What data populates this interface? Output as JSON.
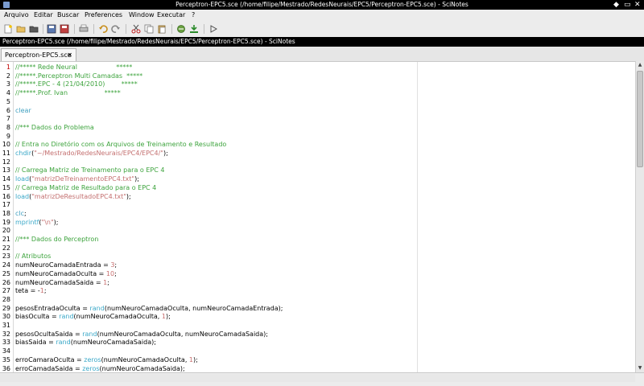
{
  "window": {
    "title": "Perceptron-EPC5.sce (/home/filipe/Mestrado/RedesNeurais/EPC5/Perceptron-EPC5.sce) - SciNotes",
    "controls": [
      "◆",
      "▭",
      "✕"
    ]
  },
  "menu": [
    {
      "label": "Arquivo"
    },
    {
      "label": "Editar"
    },
    {
      "label": "Buscar"
    },
    {
      "label": "Preferences"
    },
    {
      "label": "Window"
    },
    {
      "label": "Executar"
    },
    {
      "label": "?"
    }
  ],
  "toolbar": {
    "icons": [
      "new-file-icon",
      "open-file-icon",
      "open-recent-icon",
      "save-icon",
      "save-as-icon",
      "print-icon",
      "undo-icon",
      "redo-icon",
      "cut-icon",
      "copy-icon",
      "paste-icon",
      "execute-file-icon",
      "load-into-scilab-icon",
      "run-icon"
    ]
  },
  "pathbar": {
    "text": "Perceptron-EPC5.sce (/home/filipe/Mestrado/RedesNeurais/EPC5/Perceptron-EPC5.sce) - SciNotes"
  },
  "tab": {
    "label": "Perceptron-EPC5.sce",
    "close": "✕"
  },
  "editor": {
    "lines": [
      [
        [
          "com",
          "//***** Rede Neural                   *****"
        ]
      ],
      [
        [
          "com",
          "//*****.Perceptron Multi Camadas  *****"
        ]
      ],
      [
        [
          "com",
          "//*****.EPC - 4 (21/04/2010)        *****"
        ]
      ],
      [
        [
          "com",
          "//*****.Prof. Ivan                  *****"
        ]
      ],
      [],
      [
        [
          "kw",
          "clear"
        ]
      ],
      [],
      [
        [
          "com",
          "//*** Dados do Problema"
        ]
      ],
      [],
      [
        [
          "com",
          "// Entra no Diretório com os Arquivos de Treinamento e Resultado"
        ]
      ],
      [
        [
          "fn",
          "chdir"
        ],
        [
          "op",
          "("
        ],
        [
          "str",
          "\"~/Mestrado/RedesNeurais/EPC4/EPC4/\""
        ],
        [
          "op",
          ");"
        ]
      ],
      [],
      [
        [
          "com",
          "// Carrega Matriz de Treinamento para o EPC 4"
        ]
      ],
      [
        [
          "fn",
          "load"
        ],
        [
          "op",
          "("
        ],
        [
          "str",
          "\"matrizDeTreinamentoEPC4.txt\""
        ],
        [
          "op",
          ");"
        ]
      ],
      [
        [
          "com",
          "// Carrega Matriz de Resultado para o EPC 4"
        ]
      ],
      [
        [
          "fn",
          "load"
        ],
        [
          "op",
          "("
        ],
        [
          "str",
          "\"matrizDeResultadoEPC4.txt\""
        ],
        [
          "op",
          ");"
        ]
      ],
      [],
      [
        [
          "kw",
          "clc"
        ],
        [
          "op",
          ";"
        ]
      ],
      [
        [
          "fn",
          "mprintf"
        ],
        [
          "op",
          "("
        ],
        [
          "str",
          "\"\\n\""
        ],
        [
          "op",
          ");"
        ]
      ],
      [],
      [
        [
          "com",
          "//*** Dados do Perceptron"
        ]
      ],
      [],
      [
        [
          "com",
          "// Atributos"
        ]
      ],
      [
        [
          "id",
          "numNeuroCamadaEntrada "
        ],
        [
          "op",
          "= "
        ],
        [
          "num",
          "3"
        ],
        [
          "op",
          ";"
        ]
      ],
      [
        [
          "id",
          "numNeuroCamadaOculta "
        ],
        [
          "op",
          "= "
        ],
        [
          "num",
          "10"
        ],
        [
          "op",
          ";"
        ]
      ],
      [
        [
          "id",
          "numNeuroCamadaSaida "
        ],
        [
          "op",
          "= "
        ],
        [
          "num",
          "1"
        ],
        [
          "op",
          ";"
        ]
      ],
      [
        [
          "id",
          "teta "
        ],
        [
          "op",
          "= -"
        ],
        [
          "num",
          "1"
        ],
        [
          "op",
          ";"
        ]
      ],
      [],
      [
        [
          "id",
          "pesosEntradaOculta "
        ],
        [
          "op",
          "= "
        ],
        [
          "fn",
          "rand"
        ],
        [
          "op",
          "("
        ],
        [
          "id",
          "numNeuroCamadaOculta, numNeuroCamadaEntrada"
        ],
        [
          "op",
          ");"
        ]
      ],
      [
        [
          "id",
          "biasOculta "
        ],
        [
          "op",
          "= "
        ],
        [
          "fn",
          "rand"
        ],
        [
          "op",
          "("
        ],
        [
          "id",
          "numNeuroCamadaOculta, "
        ],
        [
          "num",
          "1"
        ],
        [
          "op",
          ");"
        ]
      ],
      [],
      [
        [
          "id",
          "pesosOcultaSaida "
        ],
        [
          "op",
          "= "
        ],
        [
          "fn",
          "rand"
        ],
        [
          "op",
          "("
        ],
        [
          "id",
          "numNeuroCamadaOculta, numNeuroCamadaSaida"
        ],
        [
          "op",
          ");"
        ]
      ],
      [
        [
          "id",
          "biasSaida "
        ],
        [
          "op",
          "= "
        ],
        [
          "fn",
          "rand"
        ],
        [
          "op",
          "("
        ],
        [
          "id",
          "numNeuroCamadaSaida"
        ],
        [
          "op",
          ");"
        ]
      ],
      [],
      [
        [
          "id",
          "erroCamaraOculta "
        ],
        [
          "op",
          "= "
        ],
        [
          "fn",
          "zeros"
        ],
        [
          "op",
          "("
        ],
        [
          "id",
          "numNeuroCamadaOculta, "
        ],
        [
          "num",
          "1"
        ],
        [
          "op",
          ");"
        ]
      ],
      [
        [
          "id",
          "erroCamadaSaida "
        ],
        [
          "op",
          "= "
        ],
        [
          "fn",
          "zeros"
        ],
        [
          "op",
          "("
        ],
        [
          "id",
          "numNeuroCamadaSaida"
        ],
        [
          "op",
          ");"
        ]
      ]
    ]
  },
  "colors": {
    "comment": "#3ca33c",
    "keyword": "#40a0c0",
    "string": "#c47070",
    "number": "#c87070",
    "titlebar_bg": "#000000",
    "active_line_number": "#c00000"
  }
}
